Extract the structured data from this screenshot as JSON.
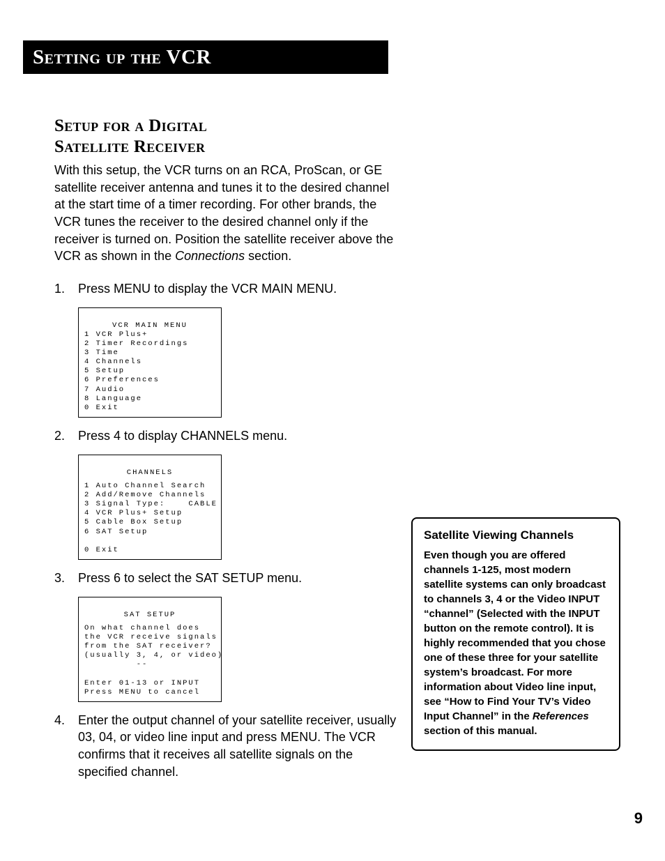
{
  "titlebar": "Setting up the VCR",
  "section_title_line1": "Setup for a Digital",
  "section_title_line2": "Satellite Receiver",
  "intro_before_italic": "With this setup, the VCR turns on an RCA, ProScan, or GE satellite receiver antenna and tunes it to the desired channel at the start time of a timer recording. For other brands, the VCR tunes the receiver to the desired channel only if the receiver is turned on. Position the satellite receiver above the VCR as shown in the ",
  "intro_italic": "Connections",
  "intro_after_italic": " section.",
  "steps": {
    "s1": {
      "n": "1.",
      "t": "Press MENU to display the VCR MAIN MENU."
    },
    "s2": {
      "n": "2.",
      "t": "Press 4 to display CHANNELS menu."
    },
    "s3": {
      "n": "3.",
      "t": "Press 6 to select the SAT SETUP menu."
    },
    "s4": {
      "n": "4.",
      "t": "Enter the output channel of your satellite receiver, usually 03, 04, or video line input and press MENU. The VCR confirms that it receives all satellite signals on the specified channel."
    }
  },
  "menu1": {
    "title": "VCR MAIN MENU",
    "lines": "1 VCR Plus+\n2 Timer Recordings\n3 Time\n4 Channels\n5 Setup\n6 Preferences\n7 Audio\n8 Language\n0 Exit"
  },
  "menu2": {
    "title": "CHANNELS",
    "lines": "1 Auto Channel Search\n2 Add/Remove Channels\n3 Signal Type:    CABLE\n4 VCR Plus+ Setup\n5 Cable Box Setup\n6 SAT Setup\n\n0 Exit"
  },
  "menu3": {
    "title": "SAT SETUP",
    "lines": "On what channel does\nthe VCR receive signals\nfrom the SAT receiver?\n(usually 3, 4, or video)\n         --\n\nEnter 01-13 or INPUT\nPress MENU to cancel"
  },
  "sidebar": {
    "title": "Satellite Viewing Channels",
    "body_before_italic": "Even though you are offered channels 1-125, most modern satellite systems can only broadcast to channels 3, 4 or the Video INPUT “channel” (Selected with the INPUT button on the remote control). It is highly recommended that you chose one of these three for your satellite system’s broadcast. For more information about Video line input, see “How to Find Your TV’s Video Input Channel” in the ",
    "body_italic": "References",
    "body_after_italic": " section of this manual."
  },
  "page_number": "9"
}
